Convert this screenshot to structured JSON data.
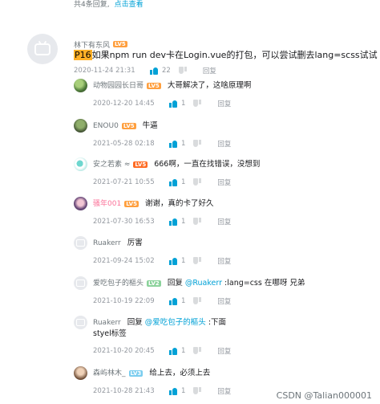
{
  "header": {
    "count_text": "共4条回复,",
    "link_text": "点击查看"
  },
  "main_comment": {
    "user": "林下有东风",
    "level": "LV5",
    "ptag": "P16",
    "text": "如果npm run dev卡在Login.vue的打包，可以尝试删去lang=scss试试",
    "time": "2020-11-24 21:31",
    "likes": "22",
    "reply_label": "回复"
  },
  "replies": [
    {
      "user": "动物园园长日哥",
      "level": "LV5",
      "text": "大哥解决了，这啥原理啊",
      "time": "2020-12-20 14:45",
      "likes": "1",
      "reply_label": "回复"
    },
    {
      "user": "ENOU0",
      "level": "LV5",
      "text": "牛逼",
      "time": "2021-05-28 02:18",
      "likes": "1",
      "reply_label": "回复"
    },
    {
      "user": "安之若素 ≈",
      "level": "LV5",
      "text": "666啊，一直在找错误，没想到",
      "time": "2021-07-21 10:55",
      "likes": "1",
      "reply_label": "回复"
    },
    {
      "user": "骚年001",
      "level": "LV5",
      "text": "谢谢，真的卡了好久",
      "time": "2021-07-30 16:53",
      "likes": "1",
      "reply_label": "回复"
    },
    {
      "user": "Ruakerr",
      "level": "",
      "text": "厉害",
      "time": "2021-09-24 15:02",
      "likes": "1",
      "reply_label": "回复"
    },
    {
      "user": "爱吃包子的樞头",
      "level": "LV2",
      "prefix": "回复 ",
      "at": "@Ruakerr",
      "text": " :lang=css 在哪呀 兄弟",
      "time": "2021-10-19 22:09",
      "likes": "1",
      "reply_label": "回复"
    },
    {
      "user": "Ruakerr",
      "level": "",
      "prefix": "回复 ",
      "at": "@爱吃包子的樞头",
      "text": " :下面",
      "text2": "styel标签",
      "time": "2021-10-20 20:45",
      "likes": "1",
      "reply_label": "回复"
    },
    {
      "user": "森屿林木_",
      "level": "LV3",
      "text": "给上去，必须上去",
      "time": "2021-10-28 21:43",
      "likes": "1",
      "reply_label": "回复"
    }
  ],
  "watermark": "CSDN @Talian000001",
  "colors": {
    "link": "#00a1d6",
    "lv5": "#ff9f3e",
    "lv6": "#ff6b23",
    "vip_name": "#fb7299"
  }
}
